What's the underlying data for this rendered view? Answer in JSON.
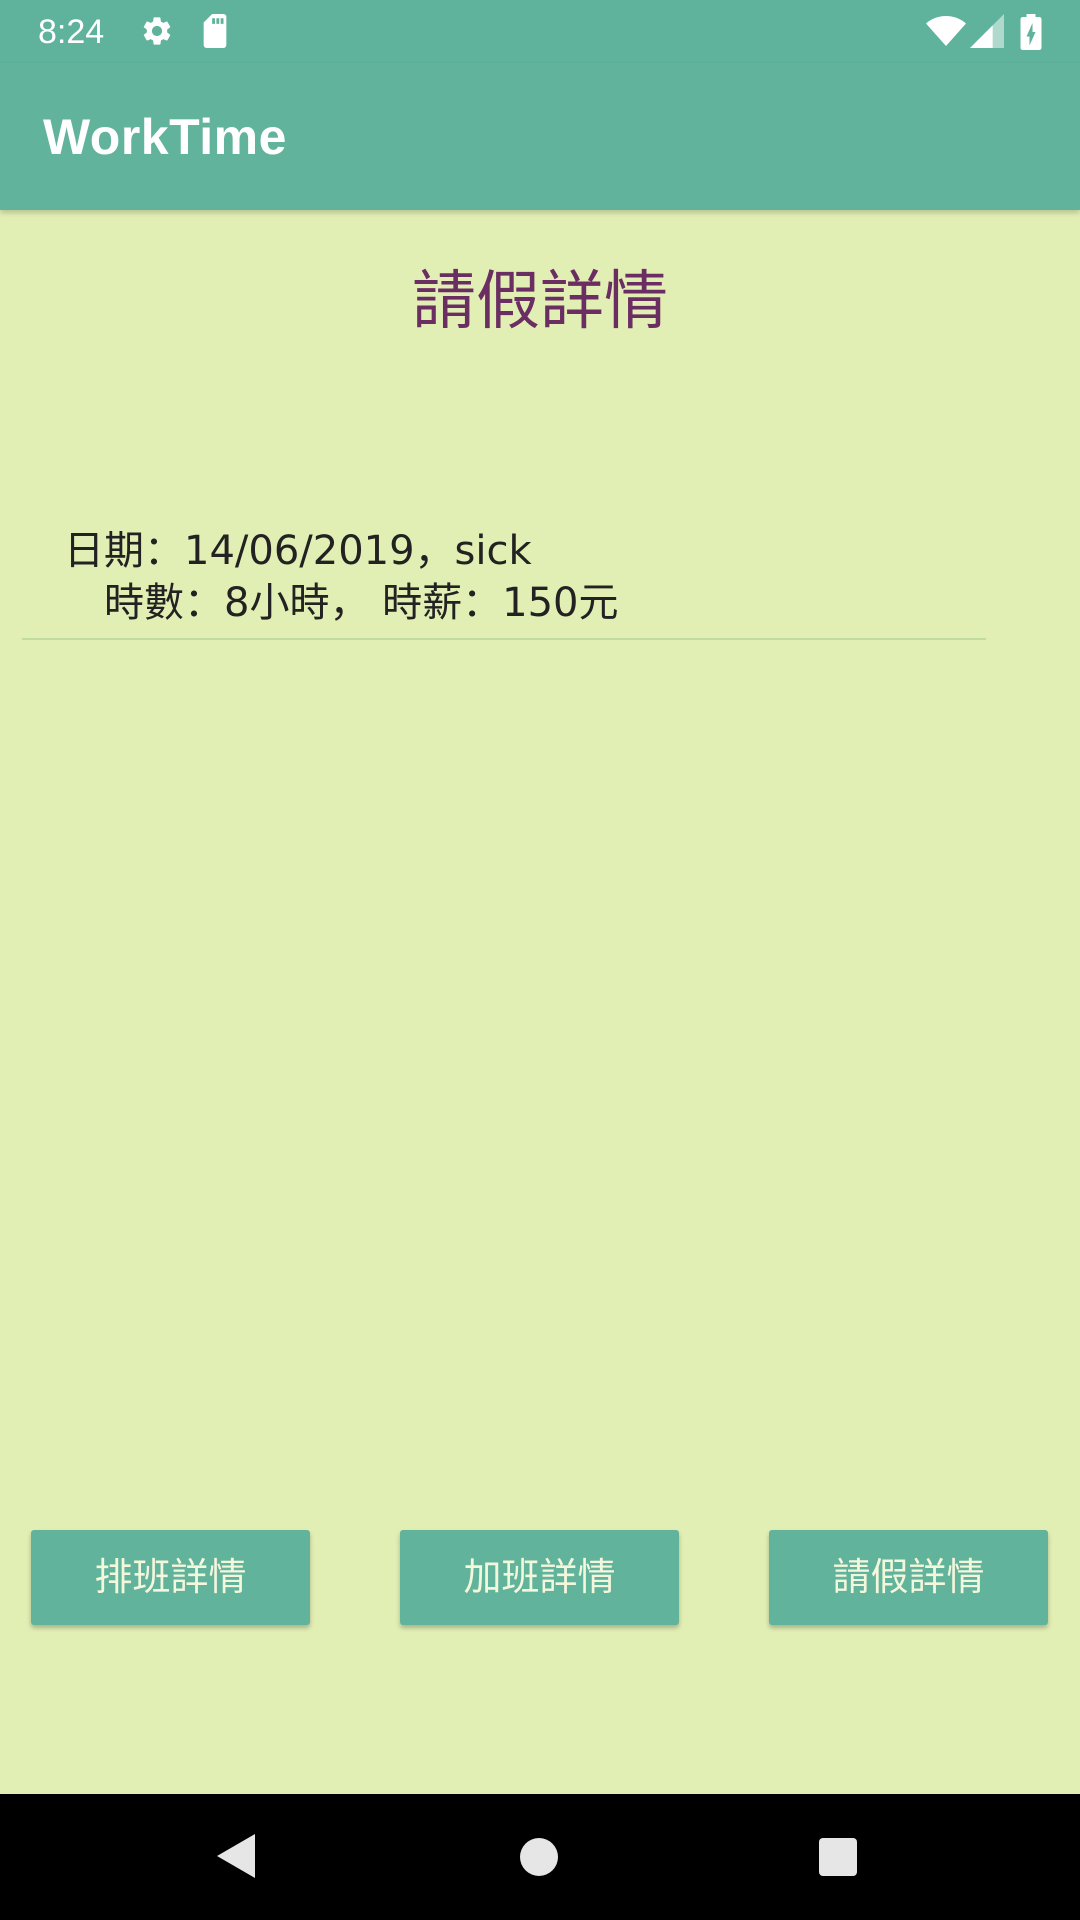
{
  "status_bar": {
    "time": "8:24",
    "icons": [
      "gear-icon",
      "sd-card-icon",
      "wifi-icon",
      "signal-icon",
      "battery-charging-icon"
    ]
  },
  "app_bar": {
    "title": "WorkTime"
  },
  "main": {
    "heading": "請假詳情",
    "records": [
      {
        "line1": "日期：14/06/2019，sick",
        "line2": "時數：8小時，  時薪：150元"
      }
    ]
  },
  "buttons": {
    "schedule": "排班詳情",
    "overtime": "加班詳情",
    "leave": "請假詳情"
  },
  "nav_bar": {
    "icons": [
      "back-icon",
      "home-icon",
      "recents-icon"
    ]
  },
  "colors": {
    "primary": "#62b39c",
    "background": "#e2efb4",
    "heading": "#6b2e63"
  }
}
